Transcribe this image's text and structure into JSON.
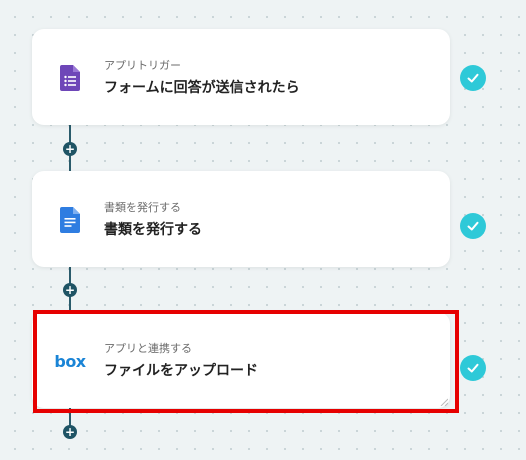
{
  "flow": {
    "steps": [
      {
        "subtitle": "アプリトリガー",
        "title": "フォームに回答が送信されたら",
        "icon": "google-forms-icon",
        "status": "complete"
      },
      {
        "subtitle": "書類を発行する",
        "title": "書類を発行する",
        "icon": "google-docs-icon",
        "status": "complete"
      },
      {
        "subtitle": "アプリと連携する",
        "title": "ファイルをアップロード",
        "icon": "box-logo-icon",
        "icon_text": "box",
        "status": "complete",
        "highlighted": true
      }
    ],
    "add_label": "+"
  },
  "colors": {
    "check": "#2ec9d8",
    "highlight": "#e60000",
    "connector": "#1f5465",
    "forms": "#6e46b8",
    "docs": "#2f7de1",
    "box": "#1a84d6"
  }
}
